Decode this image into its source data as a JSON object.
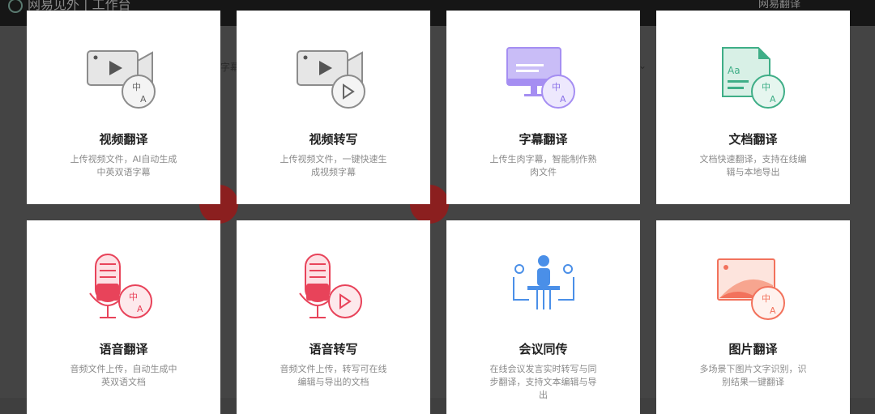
{
  "header": {
    "brand": "网易见外 | 工作台",
    "right_link": "网易翻译"
  },
  "background": {
    "tab_label": "字幕"
  },
  "cards": [
    {
      "title": "视频翻译",
      "desc": "上传视频文件，AI自动生成中英双语字幕",
      "icon": "video-translate-icon"
    },
    {
      "title": "视频转写",
      "desc": "上传视频文件，一键快速生成视频字幕",
      "icon": "video-transcribe-icon"
    },
    {
      "title": "字幕翻译",
      "desc": "上传生肉字幕，智能制作熟肉文件",
      "icon": "subtitle-translate-icon"
    },
    {
      "title": "文档翻译",
      "desc": "文档快速翻译，支持在线编辑与本地导出",
      "icon": "document-translate-icon"
    },
    {
      "title": "语音翻译",
      "desc": "音频文件上传，自动生成中英双语文档",
      "icon": "audio-translate-icon"
    },
    {
      "title": "语音转写",
      "desc": "音频文件上传，转写可在线编辑与导出的文档",
      "icon": "audio-transcribe-icon"
    },
    {
      "title": "会议同传",
      "desc": "在线会议发言实时转写与同步翻译，支持文本编辑与导出",
      "icon": "meeting-interpret-icon"
    },
    {
      "title": "图片翻译",
      "desc": "多场景下图片文字识别，识别结果一键翻译",
      "icon": "image-translate-icon"
    }
  ],
  "colors": {
    "gray": "#9a9a9a",
    "purple": "#a58ef2",
    "green": "#3fae87",
    "red": "#e8435a",
    "blue": "#4a8fe8",
    "coral": "#f2725c"
  }
}
